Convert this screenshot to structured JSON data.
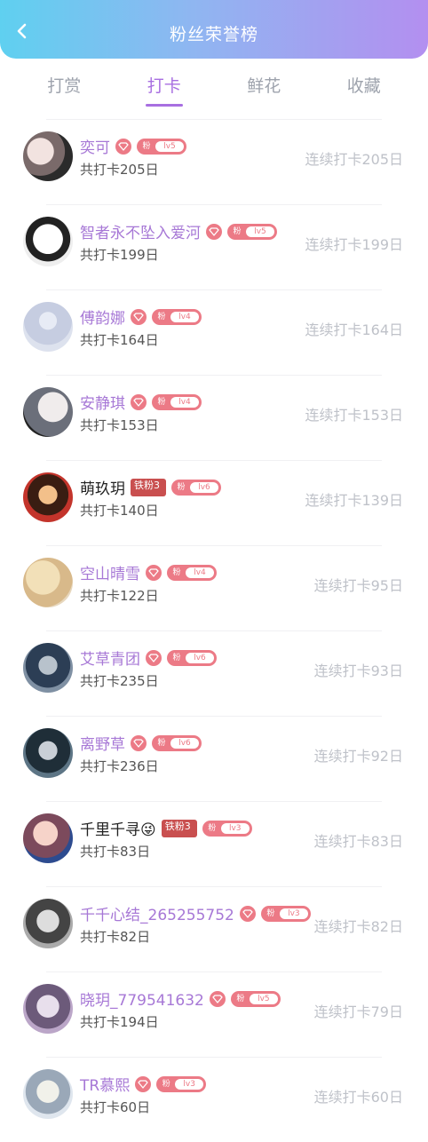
{
  "header": {
    "title": "粉丝荣誉榜",
    "back_icon": "chevron-left-icon"
  },
  "tabs": [
    {
      "label": "打赏",
      "active": false
    },
    {
      "label": "打卡",
      "active": true
    },
    {
      "label": "鲜花",
      "active": false
    },
    {
      "label": "收藏",
      "active": false
    }
  ],
  "colors": {
    "accent": "#a86fe1",
    "badge": "#ec7a86",
    "iron_badge": "#c94f4f"
  },
  "rows": [
    {
      "name": "奕可",
      "level": "lv5",
      "total": "共打卡205日",
      "streak": "连续打卡205日",
      "gem": true,
      "iron": "",
      "plain": false
    },
    {
      "name": "智者永不坠入爱河",
      "level": "lv5",
      "total": "共打卡199日",
      "streak": "连续打卡199日",
      "gem": true,
      "iron": "",
      "plain": false
    },
    {
      "name": "傅韵娜",
      "level": "lv4",
      "total": "共打卡164日",
      "streak": "连续打卡164日",
      "gem": true,
      "iron": "",
      "plain": false
    },
    {
      "name": "安静琪",
      "level": "lv4",
      "total": "共打卡153日",
      "streak": "连续打卡153日",
      "gem": true,
      "iron": "",
      "plain": false
    },
    {
      "name": "萌玖玥",
      "level": "lv6",
      "total": "共打卡140日",
      "streak": "连续打卡139日",
      "gem": false,
      "iron": "铁粉3",
      "plain": true
    },
    {
      "name": "空山晴雪",
      "level": "lv4",
      "total": "共打卡122日",
      "streak": "连续打卡95日",
      "gem": true,
      "iron": "",
      "plain": false
    },
    {
      "name": "艾草青团",
      "level": "lv6",
      "total": "共打卡235日",
      "streak": "连续打卡93日",
      "gem": true,
      "iron": "",
      "plain": false
    },
    {
      "name": "离野草",
      "level": "lv6",
      "total": "共打卡236日",
      "streak": "连续打卡92日",
      "gem": true,
      "iron": "",
      "plain": false
    },
    {
      "name": "千里千寻😜",
      "level": "lv3",
      "total": "共打卡83日",
      "streak": "连续打卡83日",
      "gem": false,
      "iron": "铁粉3",
      "plain": true
    },
    {
      "name": "千千心结_265255752",
      "level": "lv3",
      "total": "共打卡82日",
      "streak": "连续打卡82日",
      "gem": true,
      "iron": "",
      "plain": false
    },
    {
      "name": "晓玥_779541632",
      "level": "lv5",
      "total": "共打卡194日",
      "streak": "连续打卡79日",
      "gem": true,
      "iron": "",
      "plain": false
    },
    {
      "name": "TR慕熙",
      "level": "lv3",
      "total": "共打卡60日",
      "streak": "连续打卡60日",
      "gem": true,
      "iron": "",
      "plain": false
    }
  ],
  "badge_label": "粉"
}
